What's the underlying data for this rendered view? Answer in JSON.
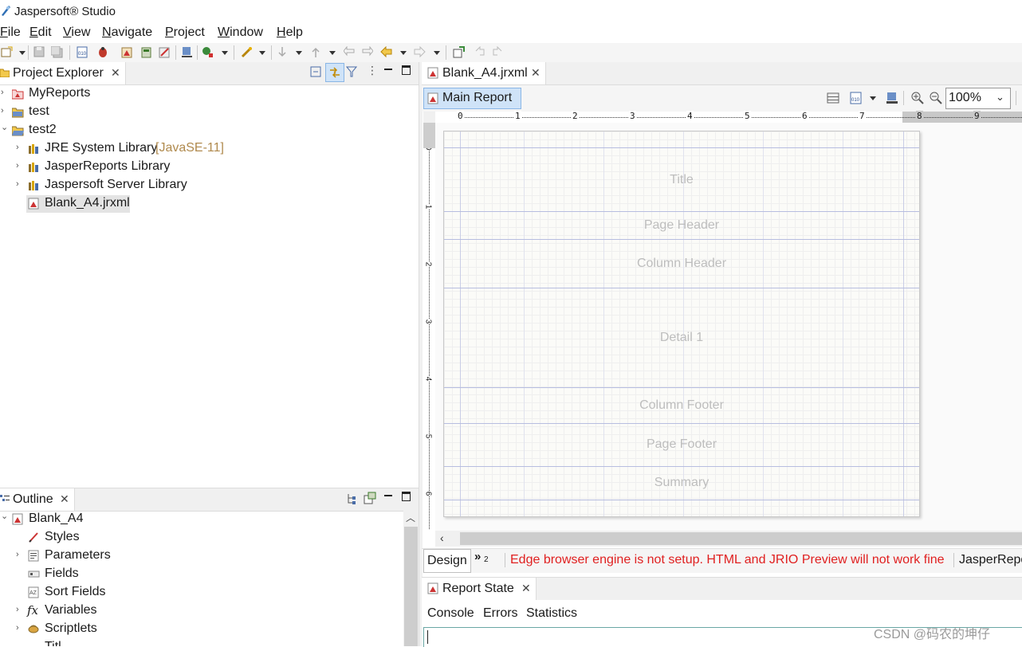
{
  "window": {
    "title": "Jaspersoft® Studio"
  },
  "menu": [
    "File",
    "Edit",
    "View",
    "Navigate",
    "Project",
    "Window",
    "Help"
  ],
  "project_explorer": {
    "tab_label": "Project Explorer",
    "items": [
      {
        "label": "MyReports",
        "depth": 0,
        "expander": "›"
      },
      {
        "label": "test",
        "depth": 0,
        "expander": "›"
      },
      {
        "label": "test2",
        "depth": 0,
        "expander": "⌄"
      },
      {
        "label": "JRE System Library",
        "suffix": "[JavaSE-11]",
        "depth": 1,
        "expander": "›"
      },
      {
        "label": "JasperReports Library",
        "depth": 1,
        "expander": "›"
      },
      {
        "label": "Jaspersoft Server Library",
        "depth": 1,
        "expander": "›"
      },
      {
        "label": "Blank_A4.jrxml",
        "depth": 1,
        "expander": ""
      }
    ]
  },
  "outline": {
    "tab_label": "Outline",
    "items": [
      {
        "label": "Blank_A4",
        "depth": 0,
        "expander": "⌄"
      },
      {
        "label": "Styles",
        "depth": 1,
        "expander": ""
      },
      {
        "label": "Parameters",
        "depth": 1,
        "expander": "›"
      },
      {
        "label": "Fields",
        "depth": 1,
        "expander": ""
      },
      {
        "label": "Sort Fields",
        "depth": 1,
        "expander": ""
      },
      {
        "label": "Variables",
        "depth": 1,
        "expander": "›"
      },
      {
        "label": "Scriptlets",
        "depth": 1,
        "expander": "›"
      },
      {
        "label": "Titl",
        "depth": 1,
        "expander": ""
      }
    ]
  },
  "editor": {
    "tab_label": "Blank_A4.jrxml",
    "subtab_label": "Main Report",
    "zoom": "100%",
    "ruler_h": [
      "0",
      "1",
      "2",
      "3",
      "4",
      "5",
      "6",
      "7",
      "8",
      "9"
    ],
    "ruler_v": [
      "0",
      "1",
      "2",
      "3",
      "4",
      "5",
      "6"
    ],
    "bands": [
      "Title",
      "Page Header",
      "Column Header",
      "Detail 1",
      "Column Footer",
      "Page Footer",
      "Summary"
    ]
  },
  "bottom_tabs": {
    "design": "Design",
    "more": "»",
    "more_count": "2",
    "error": "Edge browser engine is not setup. HTML and JRIO Preview will not work fine",
    "jasper": "JasperRepo"
  },
  "report_state": {
    "tab_label": "Report State",
    "tabs": [
      "Console",
      "Errors",
      "Statistics"
    ]
  },
  "watermark": "CSDN @码农的坤仔"
}
